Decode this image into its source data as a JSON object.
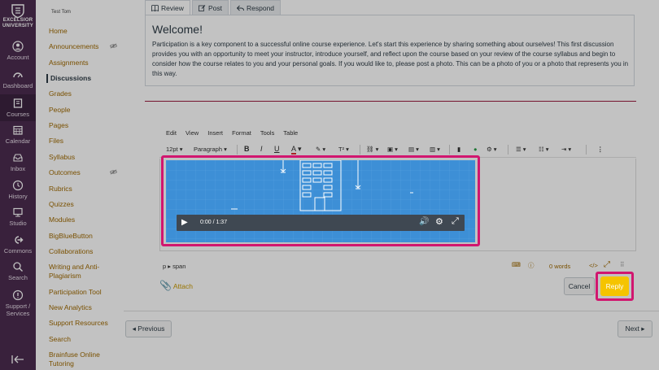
{
  "global_nav": {
    "logo_line1": "EXCELSIOR",
    "logo_line2": "UNIVERSITY",
    "items": [
      {
        "label": "Account",
        "icon": "account-icon"
      },
      {
        "label": "Dashboard",
        "icon": "dashboard-icon"
      },
      {
        "label": "Courses",
        "icon": "courses-icon"
      },
      {
        "label": "Calendar",
        "icon": "calendar-icon"
      },
      {
        "label": "Inbox",
        "icon": "inbox-icon"
      },
      {
        "label": "History",
        "icon": "history-icon"
      },
      {
        "label": "Studio",
        "icon": "studio-icon"
      },
      {
        "label": "Commons",
        "icon": "commons-icon"
      },
      {
        "label": "Search",
        "icon": "search-icon"
      },
      {
        "label": "Support /",
        "label2": "Services",
        "icon": "support-icon"
      }
    ]
  },
  "course_nav": {
    "course_name": "Test Tom",
    "items": [
      "Home",
      "Announcements",
      "Assignments",
      "Discussions",
      "Grades",
      "People",
      "Pages",
      "Files",
      "Syllabus",
      "Outcomes",
      "Rubrics",
      "Quizzes",
      "Modules",
      "BigBlueButton",
      "Collaborations",
      "Writing and Anti-",
      "Plagiarism",
      "Participation Tool",
      "New Analytics",
      "Support Resources",
      "Search",
      "Brainfuse Online",
      "Tutoring"
    ]
  },
  "tabs": {
    "review": "Review",
    "post": "Post",
    "respond": "Respond"
  },
  "discussion": {
    "title": "Welcome!",
    "body": "Participation is a key component to a successful online course experience. Let's start this experience by sharing something about ourselves! This first discussion provides you with an opportunity to meet your instructor, introduce yourself, and reflect upon the course based on your review of the course syllabus and begin to consider how the course relates to you and your personal goals. If you would like to, please post a photo. This can be a photo of you or a photo that represents you in this way."
  },
  "editor": {
    "menu": [
      "Edit",
      "View",
      "Insert",
      "Format",
      "Tools",
      "Table"
    ],
    "font_size": "12pt",
    "block_format": "Paragraph",
    "path": "p ▸ span",
    "word_count": "0 words",
    "video_time": "0:00 / 1:37"
  },
  "actions": {
    "attach": "Attach",
    "cancel": "Cancel",
    "reply": "Reply"
  },
  "footer": {
    "previous": "◂ Previous",
    "next": "Next ▸"
  },
  "colors": {
    "nav_bg": "#4b2c4f",
    "link": "#a06a00",
    "highlight": "#d1166f",
    "reply": "#f5c400",
    "video_bg": "#3d8fd6"
  }
}
